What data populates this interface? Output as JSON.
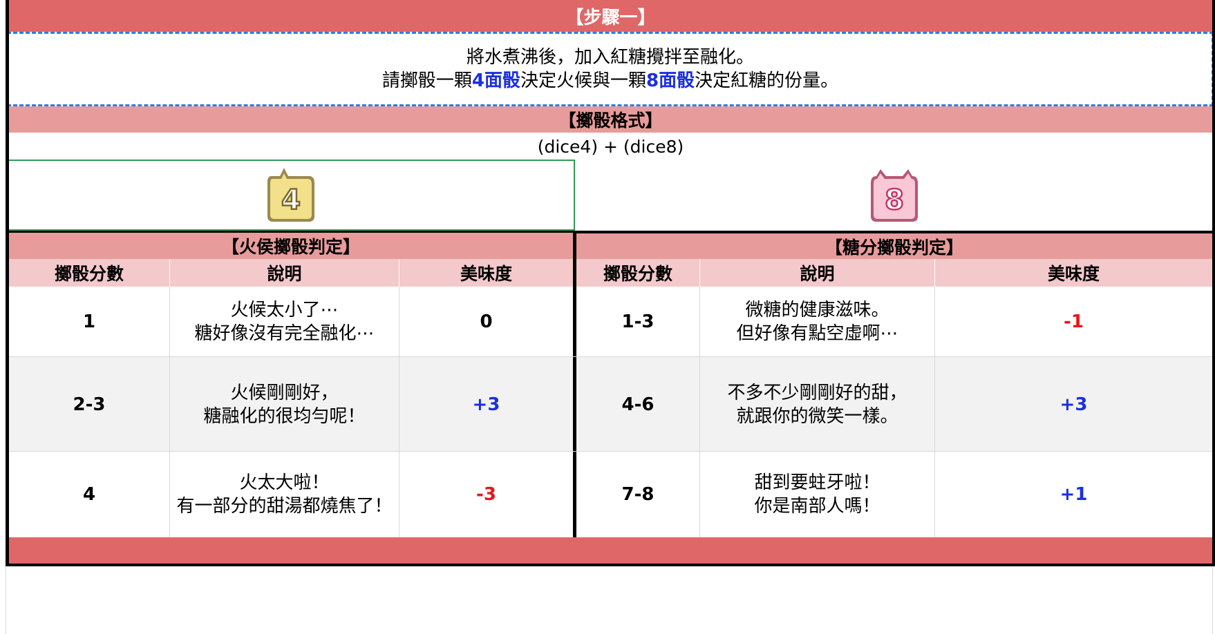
{
  "step": {
    "title": "【步驟一】"
  },
  "instructions": {
    "line1": "將水煮沸後，加入紅糖攪拌至融化。",
    "line2_pre": "請擲骰一顆",
    "line2_hl1": "4面骰",
    "line2_mid": "決定火候與一顆",
    "line2_hl2": "8面骰",
    "line2_post": "決定紅糖的份量。"
  },
  "format": {
    "title": "【擲骰格式】",
    "formula": "(dice4) + (dice8)"
  },
  "dice": {
    "left_number": "4",
    "right_number": "8",
    "left_color": "#f2e08a",
    "right_color": "#f9c7d6"
  },
  "heat_table": {
    "title": "【火侯擲骰判定】",
    "headers": {
      "score": "擲骰分數",
      "desc": "說明",
      "taste": "美味度"
    },
    "rows": [
      {
        "score": "1",
        "desc_line1": "火候太小了⋯",
        "desc_line2": "糖好像沒有完全融化⋯",
        "taste": "0"
      },
      {
        "score": "2-3",
        "desc_line1": "火候剛剛好，",
        "desc_line2": "糖融化的很均勻呢！",
        "taste": "+3"
      },
      {
        "score": "4",
        "desc_line1": "火太大啦！",
        "desc_line2": "有一部分的甜湯都燒焦了！",
        "taste": "-3"
      }
    ]
  },
  "sugar_table": {
    "title": "【糖分擲骰判定】",
    "headers": {
      "score": "擲骰分數",
      "desc": "說明",
      "taste": "美味度"
    },
    "rows": [
      {
        "score": "1-3",
        "desc_line1": "微糖的健康滋味。",
        "desc_line2": "但好像有點空虛啊⋯",
        "taste": "-1"
      },
      {
        "score": "4-6",
        "desc_line1": "不多不少剛剛好的甜，",
        "desc_line2": "就跟你的微笑一樣。",
        "taste": "+3"
      },
      {
        "score": "7-8",
        "desc_line1": "甜到要蛀牙啦！",
        "desc_line2": "你是南部人嗎！",
        "taste": "+1"
      }
    ]
  },
  "colors": {
    "band_dark": "#e06767",
    "band_mid": "#e89b9b",
    "band_light": "#f4c9cb",
    "row_alt": "#f2f2f2",
    "highlight_blue": "#1a2fe0",
    "negative_red": "#e8151c"
  }
}
